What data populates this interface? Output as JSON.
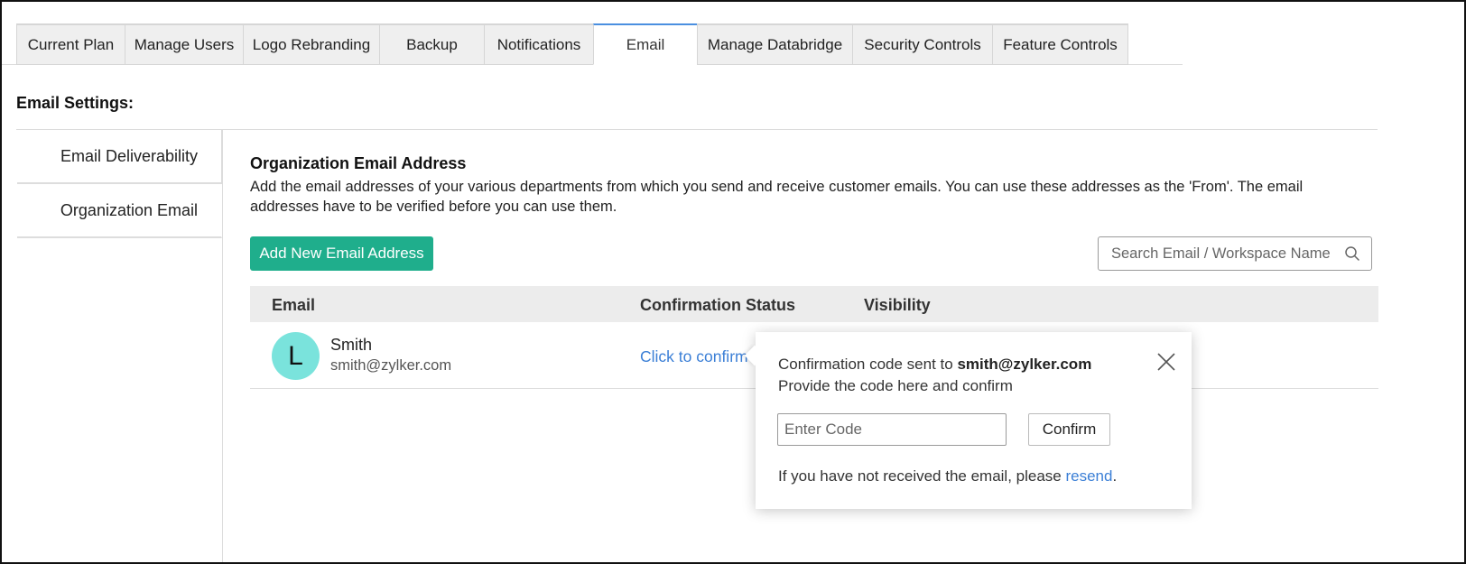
{
  "tabs": [
    {
      "label": "Current Plan",
      "active": false
    },
    {
      "label": "Manage Users",
      "active": false
    },
    {
      "label": "Logo Rebranding",
      "active": false
    },
    {
      "label": "Backup",
      "active": false
    },
    {
      "label": "Notifications",
      "active": false
    },
    {
      "label": "Email",
      "active": true
    },
    {
      "label": "Manage Databridge",
      "active": false
    },
    {
      "label": "Security Controls",
      "active": false
    },
    {
      "label": "Feature Controls",
      "active": false
    }
  ],
  "section_title": "Email Settings:",
  "sidenav": {
    "items": [
      {
        "label": "Email Deliverability",
        "active": false
      },
      {
        "label": "Organization Email",
        "active": true
      }
    ]
  },
  "main": {
    "heading": "Organization Email Address",
    "description": "Add the email addresses of your various departments from which you send and receive customer emails. You can use these addresses as the 'From'. The email addresses have to be verified before you can use them.",
    "add_button": "Add New Email Address",
    "search_placeholder": "Search Email / Workspace Name",
    "table": {
      "headers": {
        "email": "Email",
        "status": "Confirmation Status",
        "visibility": "Visibility"
      },
      "rows": [
        {
          "avatar_letter": "L",
          "name": "Smith",
          "email": "smith@zylker.com",
          "status": "Click to confirm"
        }
      ]
    }
  },
  "popup": {
    "line1_prefix": "Confirmation code sent to ",
    "line1_email": "smith@zylker.com",
    "line2": "Provide the code here and confirm",
    "code_placeholder": "Enter Code",
    "confirm_button": "Confirm",
    "footer_prefix": "If you have not received the email, please ",
    "footer_link": "resend",
    "footer_suffix": "."
  },
  "colors": {
    "accent_green": "#1fae8c",
    "link_blue": "#3b7fd6",
    "avatar_bg": "#7ae3dc",
    "active_tab_border": "#4a8fe0"
  },
  "icons": {
    "search": "search-icon",
    "close": "close-icon"
  }
}
